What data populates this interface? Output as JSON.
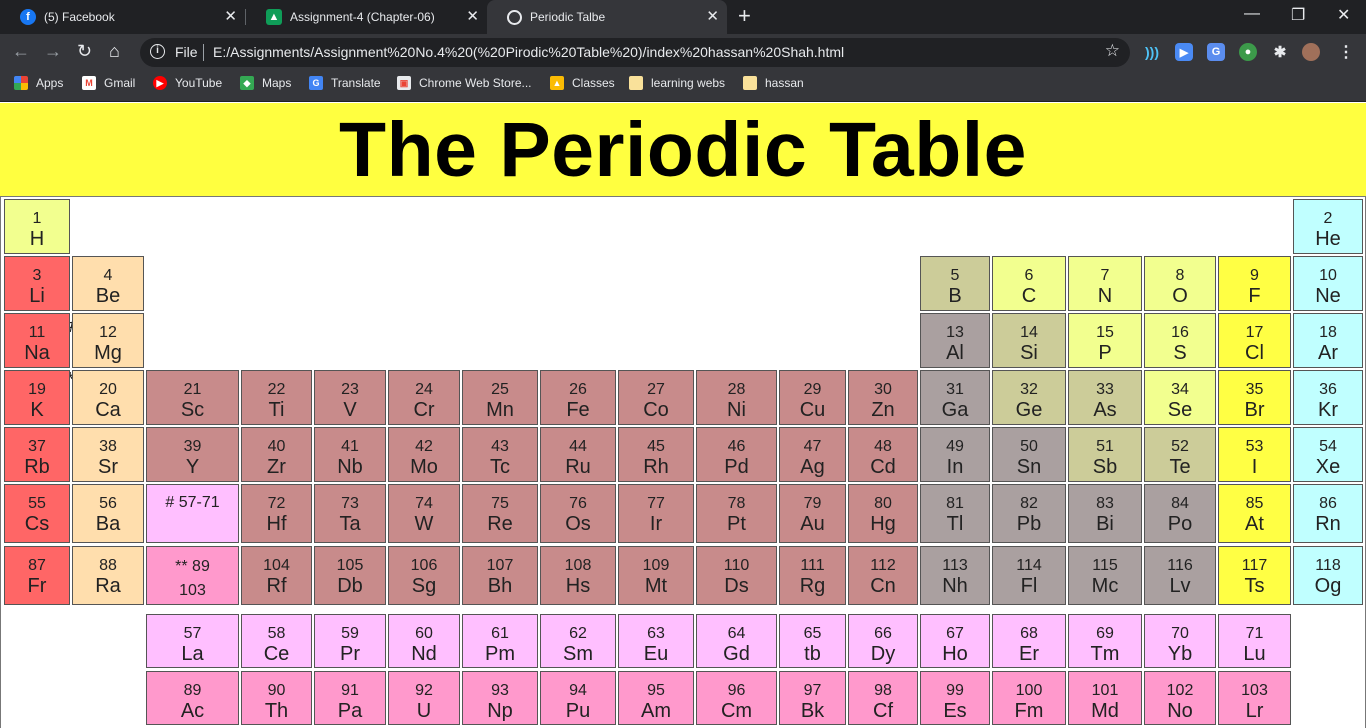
{
  "browser": {
    "tabs": [
      {
        "title": "(5) Facebook",
        "icon": "facebook-icon"
      },
      {
        "title": "Assignment-4 (Chapter-06)",
        "icon": "classroom-icon"
      },
      {
        "title": "Periodic Talbe",
        "icon": "globe-icon"
      }
    ],
    "new_tab": "+",
    "address": {
      "scheme_label": "File",
      "url": "E:/Assignments/Assignment%20No.4%20(%20Pirodic%20Table%20)/index%20hassan%20Shah.html"
    },
    "bookmarks": [
      "Apps",
      "Gmail",
      "YouTube",
      "Maps",
      "Translate",
      "Chrome Web Store...",
      "Classes",
      "learning webs",
      "hassan"
    ]
  },
  "page": {
    "title": "The Periodic Table",
    "lanthanide_marker": "#",
    "actinide_marker": "**"
  },
  "colors": {
    "alkali": "#ff6666",
    "alkaline": "#ffdead",
    "transition": "#c88b8b",
    "post_transition": "#aaa0a0",
    "metalloid": "#cccc99",
    "nonmetal": "#f2ff8f",
    "halogen": "#ffff44",
    "noble": "#c0ffff",
    "lanthanide": "#ffbfff",
    "actinide": "#ff99cc",
    "hydrogen": "#f2ff8f",
    "title_bg": "#ffff40"
  },
  "elements": [
    {
      "num": "1",
      "sym": "H",
      "row": 0,
      "col": 0,
      "cat": "hydrogen"
    },
    {
      "num": "2",
      "sym": "He",
      "row": 0,
      "col": 17,
      "cat": "noble"
    },
    {
      "num": "3",
      "sym": "Li",
      "row": 1,
      "col": 0,
      "cat": "alkali"
    },
    {
      "num": "4",
      "sym": "Be",
      "row": 1,
      "col": 1,
      "cat": "alkaline"
    },
    {
      "num": "5",
      "sym": "B",
      "row": 1,
      "col": 12,
      "cat": "metalloid"
    },
    {
      "num": "6",
      "sym": "C",
      "row": 1,
      "col": 13,
      "cat": "nonmetal"
    },
    {
      "num": "7",
      "sym": "N",
      "row": 1,
      "col": 14,
      "cat": "nonmetal"
    },
    {
      "num": "8",
      "sym": "O",
      "row": 1,
      "col": 15,
      "cat": "nonmetal"
    },
    {
      "num": "9",
      "sym": "F",
      "row": 1,
      "col": 16,
      "cat": "halogen"
    },
    {
      "num": "10",
      "sym": "Ne",
      "row": 1,
      "col": 17,
      "cat": "noble"
    },
    {
      "num": "11",
      "sym": "Na",
      "row": 2,
      "col": 0,
      "cat": "alkali"
    },
    {
      "num": "12",
      "sym": "Mg",
      "row": 2,
      "col": 1,
      "cat": "alkaline"
    },
    {
      "num": "13",
      "sym": "Al",
      "row": 2,
      "col": 12,
      "cat": "post_transition"
    },
    {
      "num": "14",
      "sym": "Si",
      "row": 2,
      "col": 13,
      "cat": "metalloid"
    },
    {
      "num": "15",
      "sym": "P",
      "row": 2,
      "col": 14,
      "cat": "nonmetal"
    },
    {
      "num": "16",
      "sym": "S",
      "row": 2,
      "col": 15,
      "cat": "nonmetal"
    },
    {
      "num": "17",
      "sym": "Cl",
      "row": 2,
      "col": 16,
      "cat": "halogen"
    },
    {
      "num": "18",
      "sym": "Ar",
      "row": 2,
      "col": 17,
      "cat": "noble"
    },
    {
      "num": "19",
      "sym": "K",
      "row": 3,
      "col": 0,
      "cat": "alkali"
    },
    {
      "num": "20",
      "sym": "Ca",
      "row": 3,
      "col": 1,
      "cat": "alkaline"
    },
    {
      "num": "21",
      "sym": "Sc",
      "row": 3,
      "col": 2,
      "cat": "transition"
    },
    {
      "num": "22",
      "sym": "Ti",
      "row": 3,
      "col": 3,
      "cat": "transition"
    },
    {
      "num": "23",
      "sym": "V",
      "row": 3,
      "col": 4,
      "cat": "transition"
    },
    {
      "num": "24",
      "sym": "Cr",
      "row": 3,
      "col": 5,
      "cat": "transition"
    },
    {
      "num": "25",
      "sym": "Mn",
      "row": 3,
      "col": 6,
      "cat": "transition"
    },
    {
      "num": "26",
      "sym": "Fe",
      "row": 3,
      "col": 7,
      "cat": "transition"
    },
    {
      "num": "27",
      "sym": "Co",
      "row": 3,
      "col": 8,
      "cat": "transition"
    },
    {
      "num": "28",
      "sym": "Ni",
      "row": 3,
      "col": 9,
      "cat": "transition"
    },
    {
      "num": "29",
      "sym": "Cu",
      "row": 3,
      "col": 10,
      "cat": "transition"
    },
    {
      "num": "30",
      "sym": "Zn",
      "row": 3,
      "col": 11,
      "cat": "transition"
    },
    {
      "num": "31",
      "sym": "Ga",
      "row": 3,
      "col": 12,
      "cat": "post_transition"
    },
    {
      "num": "32",
      "sym": "Ge",
      "row": 3,
      "col": 13,
      "cat": "metalloid"
    },
    {
      "num": "33",
      "sym": "As",
      "row": 3,
      "col": 14,
      "cat": "metalloid"
    },
    {
      "num": "34",
      "sym": "Se",
      "row": 3,
      "col": 15,
      "cat": "nonmetal"
    },
    {
      "num": "35",
      "sym": "Br",
      "row": 3,
      "col": 16,
      "cat": "halogen"
    },
    {
      "num": "36",
      "sym": "Kr",
      "row": 3,
      "col": 17,
      "cat": "noble"
    },
    {
      "num": "37",
      "sym": "Rb",
      "row": 4,
      "col": 0,
      "cat": "alkali"
    },
    {
      "num": "38",
      "sym": "Sr",
      "row": 4,
      "col": 1,
      "cat": "alkaline"
    },
    {
      "num": "39",
      "sym": "Y",
      "row": 4,
      "col": 2,
      "cat": "transition"
    },
    {
      "num": "40",
      "sym": "Zr",
      "row": 4,
      "col": 3,
      "cat": "transition"
    },
    {
      "num": "41",
      "sym": "Nb",
      "row": 4,
      "col": 4,
      "cat": "transition"
    },
    {
      "num": "42",
      "sym": "Mo",
      "row": 4,
      "col": 5,
      "cat": "transition"
    },
    {
      "num": "43",
      "sym": "Tc",
      "row": 4,
      "col": 6,
      "cat": "transition"
    },
    {
      "num": "44",
      "sym": "Ru",
      "row": 4,
      "col": 7,
      "cat": "transition"
    },
    {
      "num": "45",
      "sym": "Rh",
      "row": 4,
      "col": 8,
      "cat": "transition"
    },
    {
      "num": "46",
      "sym": "Pd",
      "row": 4,
      "col": 9,
      "cat": "transition"
    },
    {
      "num": "47",
      "sym": "Ag",
      "row": 4,
      "col": 10,
      "cat": "transition"
    },
    {
      "num": "48",
      "sym": "Cd",
      "row": 4,
      "col": 11,
      "cat": "transition"
    },
    {
      "num": "49",
      "sym": "In",
      "row": 4,
      "col": 12,
      "cat": "post_transition"
    },
    {
      "num": "50",
      "sym": "Sn",
      "row": 4,
      "col": 13,
      "cat": "post_transition"
    },
    {
      "num": "51",
      "sym": "Sb",
      "row": 4,
      "col": 14,
      "cat": "metalloid"
    },
    {
      "num": "52",
      "sym": "Te",
      "row": 4,
      "col": 15,
      "cat": "metalloid"
    },
    {
      "num": "53",
      "sym": "I",
      "row": 4,
      "col": 16,
      "cat": "halogen"
    },
    {
      "num": "54",
      "sym": "Xe",
      "row": 4,
      "col": 17,
      "cat": "noble"
    },
    {
      "num": "55",
      "sym": "Cs",
      "row": 5,
      "col": 0,
      "cat": "alkali"
    },
    {
      "num": "56",
      "sym": "Ba",
      "row": 5,
      "col": 1,
      "cat": "alkaline"
    },
    {
      "num": "# 57-71",
      "sym": "",
      "row": 5,
      "col": 2,
      "cat": "lanthanide",
      "placeholder": true
    },
    {
      "num": "72",
      "sym": "Hf",
      "row": 5,
      "col": 3,
      "cat": "transition"
    },
    {
      "num": "73",
      "sym": "Ta",
      "row": 5,
      "col": 4,
      "cat": "transition"
    },
    {
      "num": "74",
      "sym": "W",
      "row": 5,
      "col": 5,
      "cat": "transition"
    },
    {
      "num": "75",
      "sym": "Re",
      "row": 5,
      "col": 6,
      "cat": "transition"
    },
    {
      "num": "76",
      "sym": "Os",
      "row": 5,
      "col": 7,
      "cat": "transition"
    },
    {
      "num": "77",
      "sym": "Ir",
      "row": 5,
      "col": 8,
      "cat": "transition"
    },
    {
      "num": "78",
      "sym": "Pt",
      "row": 5,
      "col": 9,
      "cat": "transition"
    },
    {
      "num": "79",
      "sym": "Au",
      "row": 5,
      "col": 10,
      "cat": "transition"
    },
    {
      "num": "80",
      "sym": "Hg",
      "row": 5,
      "col": 11,
      "cat": "transition"
    },
    {
      "num": "81",
      "sym": "Tl",
      "row": 5,
      "col": 12,
      "cat": "post_transition"
    },
    {
      "num": "82",
      "sym": "Pb",
      "row": 5,
      "col": 13,
      "cat": "post_transition"
    },
    {
      "num": "83",
      "sym": "Bi",
      "row": 5,
      "col": 14,
      "cat": "post_transition"
    },
    {
      "num": "84",
      "sym": "Po",
      "row": 5,
      "col": 15,
      "cat": "post_transition"
    },
    {
      "num": "85",
      "sym": "At",
      "row": 5,
      "col": 16,
      "cat": "halogen"
    },
    {
      "num": "86",
      "sym": "Rn",
      "row": 5,
      "col": 17,
      "cat": "noble"
    },
    {
      "num": "87",
      "sym": "Fr",
      "row": 6,
      "col": 0,
      "cat": "alkali"
    },
    {
      "num": "88",
      "sym": "Ra",
      "row": 6,
      "col": 1,
      "cat": "alkaline"
    },
    {
      "num": "** 89 103",
      "sym": "",
      "row": 6,
      "col": 2,
      "cat": "actinide",
      "placeholder": true
    },
    {
      "num": "104",
      "sym": "Rf",
      "row": 6,
      "col": 3,
      "cat": "transition"
    },
    {
      "num": "105",
      "sym": "Db",
      "row": 6,
      "col": 4,
      "cat": "transition"
    },
    {
      "num": "106",
      "sym": "Sg",
      "row": 6,
      "col": 5,
      "cat": "transition"
    },
    {
      "num": "107",
      "sym": "Bh",
      "row": 6,
      "col": 6,
      "cat": "transition"
    },
    {
      "num": "108",
      "sym": "Hs",
      "row": 6,
      "col": 7,
      "cat": "transition"
    },
    {
      "num": "109",
      "sym": "Mt",
      "row": 6,
      "col": 8,
      "cat": "transition"
    },
    {
      "num": "110",
      "sym": "Ds",
      "row": 6,
      "col": 9,
      "cat": "transition"
    },
    {
      "num": "111",
      "sym": "Rg",
      "row": 6,
      "col": 10,
      "cat": "transition"
    },
    {
      "num": "112",
      "sym": "Cn",
      "row": 6,
      "col": 11,
      "cat": "transition"
    },
    {
      "num": "113",
      "sym": "Nh",
      "row": 6,
      "col": 12,
      "cat": "post_transition"
    },
    {
      "num": "114",
      "sym": "Fl",
      "row": 6,
      "col": 13,
      "cat": "post_transition"
    },
    {
      "num": "115",
      "sym": "Mc",
      "row": 6,
      "col": 14,
      "cat": "post_transition"
    },
    {
      "num": "116",
      "sym": "Lv",
      "row": 6,
      "col": 15,
      "cat": "post_transition"
    },
    {
      "num": "117",
      "sym": "Ts",
      "row": 6,
      "col": 16,
      "cat": "halogen"
    },
    {
      "num": "118",
      "sym": "Og",
      "row": 6,
      "col": 17,
      "cat": "noble"
    },
    {
      "num": "57",
      "sym": "La",
      "row": 7,
      "col": 2,
      "cat": "lanthanide"
    },
    {
      "num": "58",
      "sym": "Ce",
      "row": 7,
      "col": 3,
      "cat": "lanthanide"
    },
    {
      "num": "59",
      "sym": "Pr",
      "row": 7,
      "col": 4,
      "cat": "lanthanide"
    },
    {
      "num": "60",
      "sym": "Nd",
      "row": 7,
      "col": 5,
      "cat": "lanthanide"
    },
    {
      "num": "61",
      "sym": "Pm",
      "row": 7,
      "col": 6,
      "cat": "lanthanide"
    },
    {
      "num": "62",
      "sym": "Sm",
      "row": 7,
      "col": 7,
      "cat": "lanthanide"
    },
    {
      "num": "63",
      "sym": "Eu",
      "row": 7,
      "col": 8,
      "cat": "lanthanide"
    },
    {
      "num": "64",
      "sym": "Gd",
      "row": 7,
      "col": 9,
      "cat": "lanthanide"
    },
    {
      "num": "65",
      "sym": "tb",
      "row": 7,
      "col": 10,
      "cat": "lanthanide"
    },
    {
      "num": "66",
      "sym": "Dy",
      "row": 7,
      "col": 11,
      "cat": "lanthanide"
    },
    {
      "num": "67",
      "sym": "Ho",
      "row": 7,
      "col": 12,
      "cat": "lanthanide"
    },
    {
      "num": "68",
      "sym": "Er",
      "row": 7,
      "col": 13,
      "cat": "lanthanide"
    },
    {
      "num": "69",
      "sym": "Tm",
      "row": 7,
      "col": 14,
      "cat": "lanthanide"
    },
    {
      "num": "70",
      "sym": "Yb",
      "row": 7,
      "col": 15,
      "cat": "lanthanide"
    },
    {
      "num": "71",
      "sym": "Lu",
      "row": 7,
      "col": 16,
      "cat": "lanthanide"
    },
    {
      "num": "89",
      "sym": "Ac",
      "row": 8,
      "col": 2,
      "cat": "actinide"
    },
    {
      "num": "90",
      "sym": "Th",
      "row": 8,
      "col": 3,
      "cat": "actinide"
    },
    {
      "num": "91",
      "sym": "Pa",
      "row": 8,
      "col": 4,
      "cat": "actinide"
    },
    {
      "num": "92",
      "sym": "U",
      "row": 8,
      "col": 5,
      "cat": "actinide"
    },
    {
      "num": "93",
      "sym": "Np",
      "row": 8,
      "col": 6,
      "cat": "actinide"
    },
    {
      "num": "94",
      "sym": "Pu",
      "row": 8,
      "col": 7,
      "cat": "actinide"
    },
    {
      "num": "95",
      "sym": "Am",
      "row": 8,
      "col": 8,
      "cat": "actinide"
    },
    {
      "num": "96",
      "sym": "Cm",
      "row": 8,
      "col": 9,
      "cat": "actinide"
    },
    {
      "num": "97",
      "sym": "Bk",
      "row": 8,
      "col": 10,
      "cat": "actinide"
    },
    {
      "num": "98",
      "sym": "Cf",
      "row": 8,
      "col": 11,
      "cat": "actinide"
    },
    {
      "num": "99",
      "sym": "Es",
      "row": 8,
      "col": 12,
      "cat": "actinide"
    },
    {
      "num": "100",
      "sym": "Fm",
      "row": 8,
      "col": 13,
      "cat": "actinide"
    },
    {
      "num": "101",
      "sym": "Md",
      "row": 8,
      "col": 14,
      "cat": "actinide"
    },
    {
      "num": "102",
      "sym": "No",
      "row": 8,
      "col": 15,
      "cat": "actinide"
    },
    {
      "num": "103",
      "sym": "Lr",
      "row": 8,
      "col": 16,
      "cat": "actinide"
    }
  ]
}
